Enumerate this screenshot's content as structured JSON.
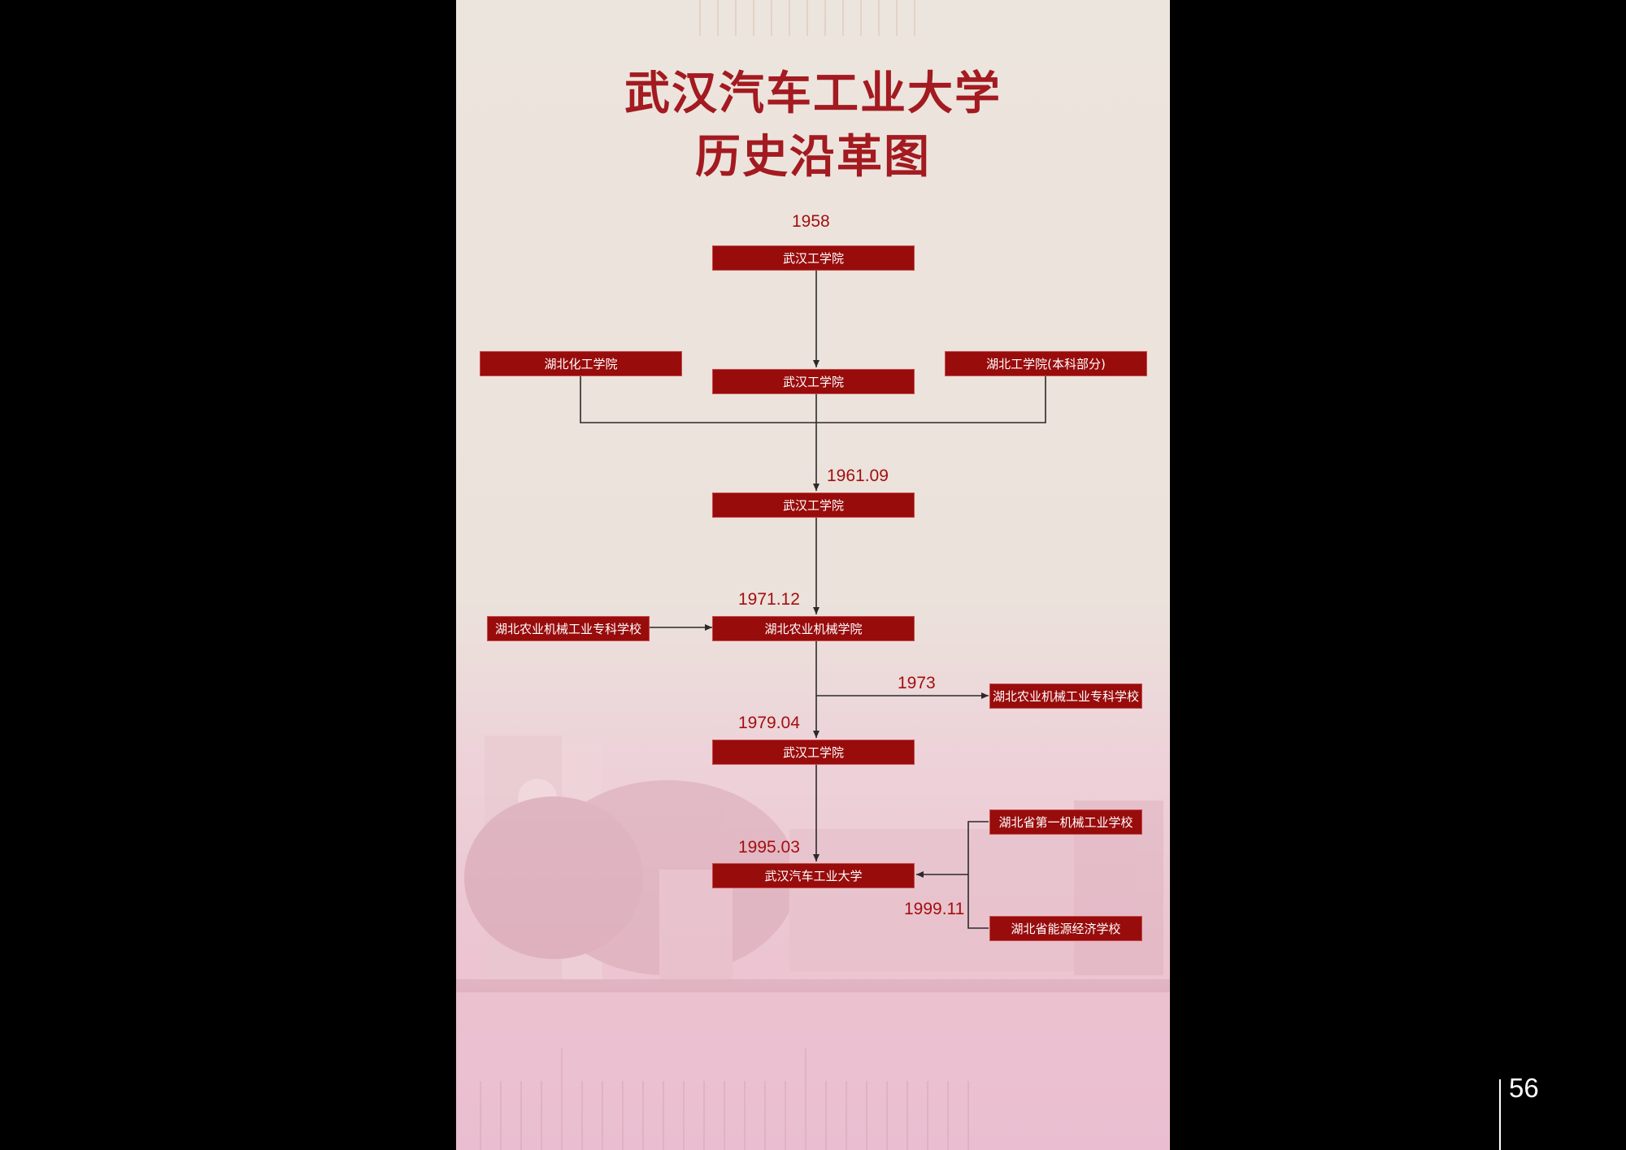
{
  "title": {
    "line1": "武汉汽车工业大学",
    "line2": "历史沿革图"
  },
  "nodes": {
    "wuhan_1958": "武汉工学院",
    "hubei_chem": "湖北化工学院",
    "wuhan_merge": "武汉工学院",
    "hubei_eng": "湖北工学院(本科部分)",
    "wuhan_1961": "武汉工学院",
    "hubei_agri_college": "湖北农业机械学院",
    "hubei_agri_school_in": "湖北农业机械工业专科学校",
    "hubei_agri_school_out": "湖北农业机械工业专科学校",
    "wuhan_1979": "武汉工学院",
    "wuhan_auto_univ": "武汉汽车工业大学",
    "hubei_no1_machine": "湖北省第一机械工业学校",
    "hubei_energy_econ": "湖北省能源经济学校"
  },
  "years": {
    "y1958": "1958",
    "y1961": "1961.09",
    "y1971": "1971.12",
    "y1973": "1973",
    "y1979": "1979.04",
    "y1995": "1995.03",
    "y1999": "1999.11"
  },
  "page_number": "56",
  "colors": {
    "accent": "#a31a20",
    "box_fill": "#980c0c",
    "line": "#2a2a2a"
  }
}
